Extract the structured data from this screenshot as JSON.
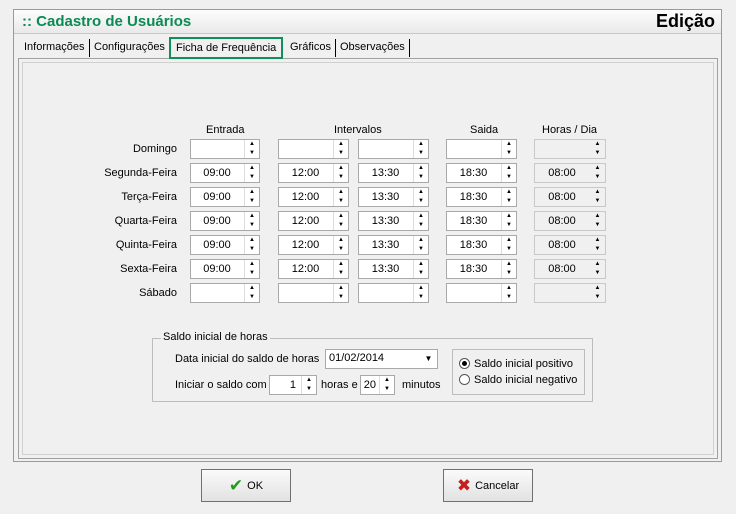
{
  "window": {
    "title": ":: Cadastro de Usuários",
    "mode": "Edição"
  },
  "tabs": [
    {
      "label": "Informações"
    },
    {
      "label": "Configurações"
    },
    {
      "label": "Ficha de Frequência"
    },
    {
      "label": "Gráficos"
    },
    {
      "label": "Observações"
    }
  ],
  "schedule": {
    "headers": {
      "entrada": "Entrada",
      "intervalos": "Intervalos",
      "saida": "Saida",
      "horas": "Horas / Dia"
    },
    "rows": [
      {
        "day": "Domingo",
        "entrada": "",
        "int1": "",
        "int2": "",
        "saida": "",
        "horas": ""
      },
      {
        "day": "Segunda-Feira",
        "entrada": "09:00",
        "int1": "12:00",
        "int2": "13:30",
        "saida": "18:30",
        "horas": "08:00"
      },
      {
        "day": "Terça-Feira",
        "entrada": "09:00",
        "int1": "12:00",
        "int2": "13:30",
        "saida": "18:30",
        "horas": "08:00"
      },
      {
        "day": "Quarta-Feira",
        "entrada": "09:00",
        "int1": "12:00",
        "int2": "13:30",
        "saida": "18:30",
        "horas": "08:00"
      },
      {
        "day": "Quinta-Feira",
        "entrada": "09:00",
        "int1": "12:00",
        "int2": "13:30",
        "saida": "18:30",
        "horas": "08:00"
      },
      {
        "day": "Sexta-Feira",
        "entrada": "09:00",
        "int1": "12:00",
        "int2": "13:30",
        "saida": "18:30",
        "horas": "08:00"
      },
      {
        "day": "Sábado",
        "entrada": "",
        "int1": "",
        "int2": "",
        "saida": "",
        "horas": ""
      }
    ]
  },
  "saldo": {
    "legend": "Saldo inicial de horas",
    "date_label": "Data inicial do saldo de horas",
    "date_value": "01/02/2014",
    "start_label": "Iniciar o saldo com",
    "hours_value": "1",
    "hours_label": "horas e",
    "minutes_value": "20",
    "minutes_label": "minutos",
    "radio_positive": "Saldo inicial positivo",
    "radio_negative": "Saldo inicial negativo",
    "selected": "positive"
  },
  "buttons": {
    "ok": "OK",
    "cancel": "Cancelar"
  }
}
